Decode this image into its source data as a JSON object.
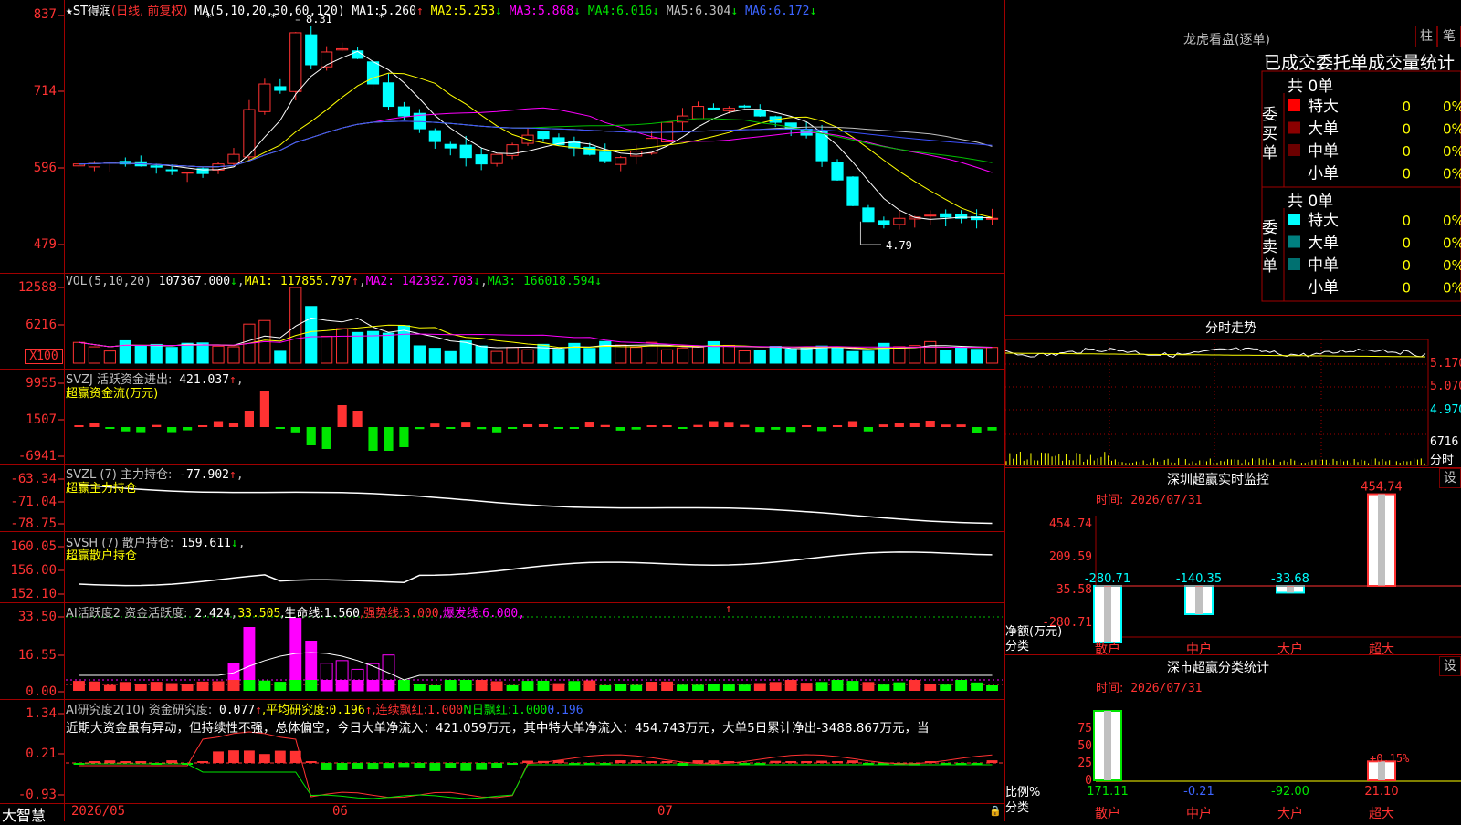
{
  "colors": {
    "up": "#ff3232",
    "down": "#00ffff",
    "frame": "#a00000",
    "ma1": "#ffffff",
    "ma2": "#ffff00",
    "ma3": "#ff00ff",
    "ma4": "#00c000",
    "ma5": "#c0c0c0",
    "ma6": "#3c50ff",
    "bg": "#000000"
  },
  "kline": {
    "icon": "★",
    "name": "ST得润",
    "period_note": "(日线, 前复权)",
    "ma_label": "MA(5,10,20,30,60,120)",
    "ma": [
      {
        "name": "MA1:",
        "value": "5.260",
        "arrow": "↑"
      },
      {
        "name": "MA2:",
        "value": "5.253",
        "arrow": "↓"
      },
      {
        "name": "MA3:",
        "value": "5.868",
        "arrow": "↓"
      },
      {
        "name": "MA4:",
        "value": "6.016",
        "arrow": "↓"
      },
      {
        "name": "MA5:",
        "value": "6.304",
        "arrow": "↓"
      },
      {
        "name": "MA6:",
        "value": "6.172",
        "arrow": "↓"
      }
    ],
    "y_ticks": [
      "837",
      "714",
      "596",
      "479"
    ],
    "high_label": "8.31",
    "low_label": "4.79",
    "star": "*"
  },
  "vol": {
    "label": "VOL(5,10,20)",
    "value": "107367.000",
    "v_arrow": "↓",
    "ma": [
      {
        "name": "MA1:",
        "value": "117855.797",
        "arrow": "↑"
      },
      {
        "name": "MA2:",
        "value": "142392.703",
        "arrow": "↓"
      },
      {
        "name": "MA3:",
        "value": "166018.594",
        "arrow": "↓"
      }
    ],
    "y_ticks": [
      "12588",
      "6216"
    ],
    "unit": "X100"
  },
  "svzj": {
    "label": "SVZJ  活跃资金进出:",
    "value": "421.037",
    "arrow": "↑",
    "comma": ",",
    "sub": "超赢资金流(万元)",
    "y_ticks": [
      "9955",
      "1507",
      "-6941"
    ]
  },
  "svzl": {
    "label": "SVZL (7) 主力持仓:",
    "value": "-77.902",
    "arrow": "↑",
    "comma": ",",
    "sub": "超赢主力持仓",
    "y_ticks": [
      "-63.34",
      "-71.04",
      "-78.75"
    ]
  },
  "svsh": {
    "label": "SVSH (7) 散户持仓:",
    "value": "159.611",
    "arrow": "↓",
    "comma": ",",
    "sub": "超赢散户持仓",
    "y_ticks": [
      "160.05",
      "156.00",
      "152.10"
    ]
  },
  "ai2": {
    "label": "AI活跃度2 资金活跃度:",
    "value": "2.424",
    "sep": ",",
    "v2": "33.505",
    "life": ",生命线:",
    "life_value": "1.560",
    "strong": ",强势线:",
    "strong_value": "3.000",
    "burst": ",爆发线:",
    "burst_value": "6.000,",
    "y_ticks": [
      "33.50",
      "16.55",
      "0.00"
    ]
  },
  "airesearch": {
    "label": "AI研究度2(10) 资金研究度:",
    "value": "0.077",
    "arrow": "↑",
    "avg": ",平均研究度:",
    "avg_value": "0.196",
    "avg_arrow": "↑",
    "lx": ",连续飘红:",
    "lx_value": "1.000",
    "nday": "N日飘红:",
    "nday_value": "1.000",
    "last": "0.196",
    "text": "近期大资金虽有异动，但持续性不强，总体偏空，今日大单净流入：421.059万元，其中特大单净流入：454.743万元，大单5日累计净出-3488.867万元，当",
    "y_ticks": [
      "1.34",
      "0.21",
      "-0.93"
    ]
  },
  "bottom": {
    "brand": "大智慧",
    "dates": [
      "2026/05",
      "06",
      "07"
    ]
  },
  "right": {
    "top_title": "龙虎看盘(逐单)",
    "btn1": "柱",
    "btn2": "笔",
    "table_title": "已成交委托单成交量统计",
    "buy": {
      "side": "委买单",
      "count": "共 0单",
      "rows": [
        {
          "label": "特大",
          "qty": "0",
          "pct": "0%"
        },
        {
          "label": "大单",
          "qty": "0",
          "pct": "0%"
        },
        {
          "label": "中单",
          "qty": "0",
          "pct": "0%"
        },
        {
          "label": "小单",
          "qty": "0",
          "pct": "0%"
        }
      ]
    },
    "sell": {
      "side": "委卖单",
      "count": "共 0单",
      "rows": [
        {
          "label": "特大",
          "qty": "0",
          "pct": "0%"
        },
        {
          "label": "大单",
          "qty": "0",
          "pct": "0%"
        },
        {
          "label": "中单",
          "qty": "0",
          "pct": "0%"
        },
        {
          "label": "小单",
          "qty": "0",
          "pct": "0%"
        }
      ]
    },
    "intraday_title": "分时走势",
    "intraday_ticks": [
      "5.170",
      "5.070",
      "4.970"
    ],
    "intraday_vol": "6716",
    "intraday_unit": "分时",
    "sz_monitor": {
      "title": "深圳超赢实时监控",
      "btn": "设",
      "date_label": "时间:",
      "date": "2026/07/31",
      "y_ticks": [
        "454.74",
        "209.59",
        "-35.58",
        "-280.71"
      ],
      "ylabel": "净额(万元)",
      "xlabel": "分类",
      "categories": [
        "散户",
        "中户",
        "大户",
        "超大"
      ],
      "values": [
        -280.71,
        -140.35,
        -33.68,
        454.74
      ],
      "value_labels": [
        "-280.71",
        "-140.35",
        "-33.68",
        "454.74"
      ]
    },
    "sz_class": {
      "title": "深市超赢分类统计",
      "btn": "设",
      "date_label": "时间:",
      "date": "2026/07/31",
      "y_ticks": [
        "75",
        "50",
        "25",
        "0"
      ],
      "ylabel": "比例%",
      "xlabel": "分类",
      "categories": [
        "散户",
        "中户",
        "大户",
        "超大"
      ],
      "values": [
        171.11,
        -0.21,
        -92.0,
        21.1
      ],
      "value_labels": [
        "171.11",
        "-0.21",
        "-92.00",
        "21.10"
      ],
      "note": "+0.15%"
    }
  }
}
